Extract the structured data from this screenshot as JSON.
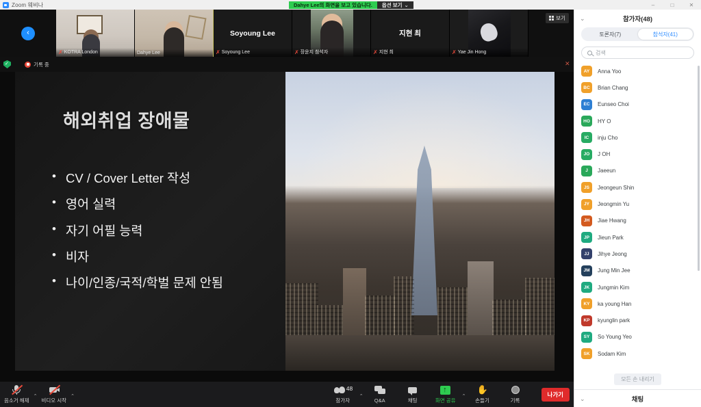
{
  "window": {
    "app_title": "Zoom 웨비나",
    "controls": {
      "minimize": "–",
      "maximize": "□",
      "close": "✕"
    }
  },
  "share_notice": {
    "text": "Dahye Lee의 화면을 보고 있습니다.",
    "options_label": "옵션 보기",
    "options_caret": "⌄",
    "bg_color": "#2ecc50"
  },
  "thumbnail_strip": {
    "prev_arrow": "‹",
    "view_button": "보기",
    "participants": [
      {
        "name": "KOTRA London",
        "muted": true,
        "has_video": true,
        "active": false
      },
      {
        "name": "Dahye Lee",
        "muted": false,
        "has_video": true,
        "active": true
      },
      {
        "name": "Soyoung Lee",
        "muted": true,
        "has_video": false,
        "active": false
      },
      {
        "name": "장윤지 참석자",
        "muted": true,
        "has_video": true,
        "active": false
      },
      {
        "name": "지현 최",
        "muted": true,
        "has_video": false,
        "active": false
      },
      {
        "name": "Yae Jin Hong",
        "muted": true,
        "has_video": true,
        "active": false
      }
    ]
  },
  "share_header": {
    "recording_label": "기록 중",
    "close": "✕"
  },
  "slide": {
    "title": "해외취업 장애물",
    "bullets": [
      "CV / Cover Letter 작성",
      "영어 실력",
      "자기 어필 능력",
      "비자",
      "나이/인종/국적/학벌 문제 안됨"
    ]
  },
  "toolbar": {
    "mute_label": "음소거 해제",
    "video_label": "비디오 시작",
    "participants_label": "참가자",
    "participants_count": "48",
    "qa_label": "Q&A",
    "chat_label": "채팅",
    "share_label": "화면 공유",
    "raise_hand_label": "손들기",
    "record_label": "기록",
    "leave_label": "나가기",
    "caret": "⌃",
    "leave_color": "#e02b2b",
    "share_color": "#2ecc50"
  },
  "panel": {
    "title": "참가자(48)",
    "collapse_caret": "⌄",
    "tabs": [
      {
        "label": "토론자(7)",
        "active": false
      },
      {
        "label": "참석자(41)",
        "active": true
      }
    ],
    "search_placeholder": "검색",
    "lower_all_hands_label": "모든 손 내리기",
    "chat_section_title": "채팅",
    "chat_collapse_caret": "⌄",
    "attendees": [
      {
        "initials": "AY",
        "name": "Anna Yoo",
        "color": "#f0a02a"
      },
      {
        "initials": "BC",
        "name": "Brian Chang",
        "color": "#f0a02a"
      },
      {
        "initials": "EC",
        "name": "Eunseo Choi",
        "color": "#2d7fd3"
      },
      {
        "initials": "HO",
        "name": "HY O",
        "color": "#2aa85a"
      },
      {
        "initials": "IC",
        "name": "inju Cho",
        "color": "#27ab63"
      },
      {
        "initials": "JO",
        "name": "J OH",
        "color": "#27ab63"
      },
      {
        "initials": "J",
        "name": "Jaeeun",
        "color": "#2aa85a"
      },
      {
        "initials": "JS",
        "name": "Jeongeun Shin",
        "color": "#f0a02a"
      },
      {
        "initials": "JY",
        "name": "Jeongmin Yu",
        "color": "#f0a02a"
      },
      {
        "initials": "JH",
        "name": "Jiae Hwang",
        "color": "#d35a1f"
      },
      {
        "initials": "JP",
        "name": "Jieun Park",
        "color": "#1faa80"
      },
      {
        "initials": "JJ",
        "name": "Jihye Jeong",
        "color": "#33406b"
      },
      {
        "initials": "JM",
        "name": "Jung Min Jee",
        "color": "#24405c"
      },
      {
        "initials": "JK",
        "name": "Jungmin Kim",
        "color": "#1faa80"
      },
      {
        "initials": "KY",
        "name": "ka young Han",
        "color": "#f0a02a"
      },
      {
        "initials": "KP",
        "name": "kyunglin park",
        "color": "#c0392b"
      },
      {
        "initials": "SY",
        "name": "So Young Yeo",
        "color": "#1faa80"
      },
      {
        "initials": "SK",
        "name": "Sodam Kim",
        "color": "#f0a02a"
      }
    ]
  }
}
